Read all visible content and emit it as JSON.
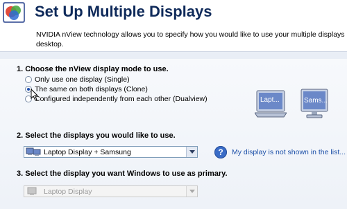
{
  "header": {
    "title": "Set Up Multiple Displays",
    "icon": "nvidia-control-panel-icon"
  },
  "intro": {
    "line1": "NVIDIA nView technology allows you to specify how you would like to use your multiple displays. Clone is great for pr",
    "line2": "desktop."
  },
  "section1": {
    "label": "1. Choose the nView display mode to use.",
    "options": [
      {
        "label": "Only use one display (Single)",
        "checked": false
      },
      {
        "label": "The same on both displays (Clone)",
        "checked": true
      },
      {
        "label": "Configured independently from each other (Dualview)",
        "checked": false
      }
    ],
    "monitors": [
      {
        "label": "Lapt..."
      },
      {
        "label": "Sams..."
      }
    ]
  },
  "section2": {
    "label": "2. Select the displays you would like to use.",
    "selected": "Laptop Display + Samsung",
    "help_link": "My display is not shown in the list..."
  },
  "section3": {
    "label": "3. Select the display you want Windows to use as primary.",
    "selected": "Laptop Display"
  },
  "colors": {
    "title": "#0f2a5a",
    "link": "#1c4fa8",
    "background": "#e9eef6"
  }
}
